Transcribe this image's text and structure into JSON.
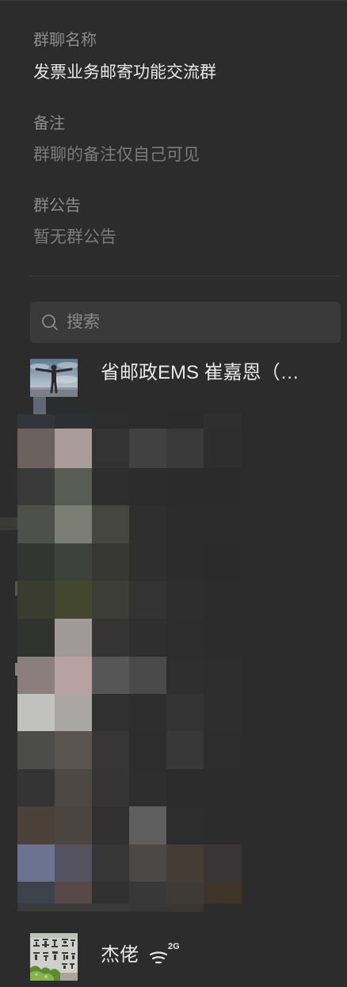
{
  "theme": {
    "background": "#2c2c2c",
    "text_primary": "#e8e8e8",
    "text_secondary": "#8c8c8c",
    "text_muted": "#7b7b7b",
    "divider": "#3b3b3b",
    "search_background": "#3a3a3a"
  },
  "group_info": {
    "name_label": "群聊名称",
    "name_value": "发票业务邮寄功能交流群",
    "remark_label": "备注",
    "remark_placeholder": "群聊的备注仅自己可见",
    "announcement_label": "群公告",
    "announcement_value": "暂无群公告"
  },
  "search": {
    "icon": "search-icon",
    "placeholder": "搜索"
  },
  "members": [
    {
      "name": "省邮政EMS 崔嘉恩（…",
      "avatar": "person-photo-avatar"
    },
    {
      "name": "杰佬",
      "avatar": "calligraphy-stone-avatar",
      "status_icon": "signal-icon",
      "status_text": "2G"
    }
  ]
}
